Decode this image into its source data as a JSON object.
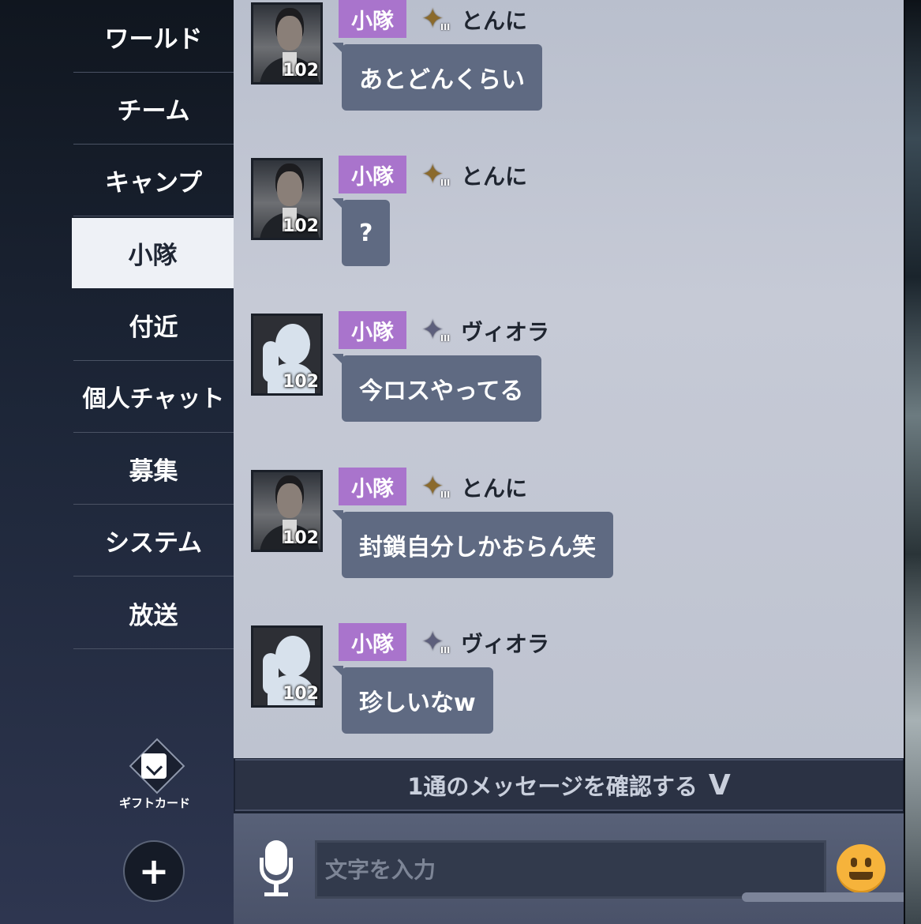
{
  "sidebar": {
    "tabs": [
      {
        "label": "ワールド"
      },
      {
        "label": "チーム"
      },
      {
        "label": "キャンプ"
      },
      {
        "label": "小隊",
        "active": true
      },
      {
        "label": "付近"
      },
      {
        "label": "個人チャット"
      },
      {
        "label": "募集"
      },
      {
        "label": "システム"
      },
      {
        "label": "放送"
      }
    ],
    "gift_card_label": "ギフトカード",
    "plus_label": "+"
  },
  "messages": [
    {
      "tag": "小隊",
      "name": "とんに",
      "rank_badge": "gold",
      "rank_num": "III",
      "avatar": "male-portrait",
      "level": "102",
      "text": "あとどんくらい"
    },
    {
      "tag": "小隊",
      "name": "とんに",
      "rank_badge": "gold",
      "rank_num": "III",
      "avatar": "male-portrait",
      "level": "102",
      "text": "?"
    },
    {
      "tag": "小隊",
      "name": "ヴィオラ",
      "rank_badge": "silver",
      "rank_num": "III",
      "avatar": "female-silhouette",
      "level": "102",
      "text": "今ロスやってる"
    },
    {
      "tag": "小隊",
      "name": "とんに",
      "rank_badge": "gold",
      "rank_num": "III",
      "avatar": "male-portrait",
      "level": "102",
      "text": "封鎖自分しかおらん笑"
    },
    {
      "tag": "小隊",
      "name": "ヴィオラ",
      "rank_badge": "silver",
      "rank_num": "III",
      "avatar": "female-silhouette",
      "level": "102",
      "text": "珍しいなw"
    }
  ],
  "new_message_bar": {
    "text": "1通のメッセージを確認する",
    "chevron": "V"
  },
  "input": {
    "placeholder": "文字を入力",
    "value": ""
  },
  "colors": {
    "tag_bg": "#a974cc",
    "bubble_bg": "#5f6a82",
    "active_tab_bg": "#eef1f6",
    "emoji": "#f6b33b"
  },
  "icons": [
    "mic-icon",
    "emoji-icon",
    "gift-card-icon",
    "plus-icon"
  ]
}
